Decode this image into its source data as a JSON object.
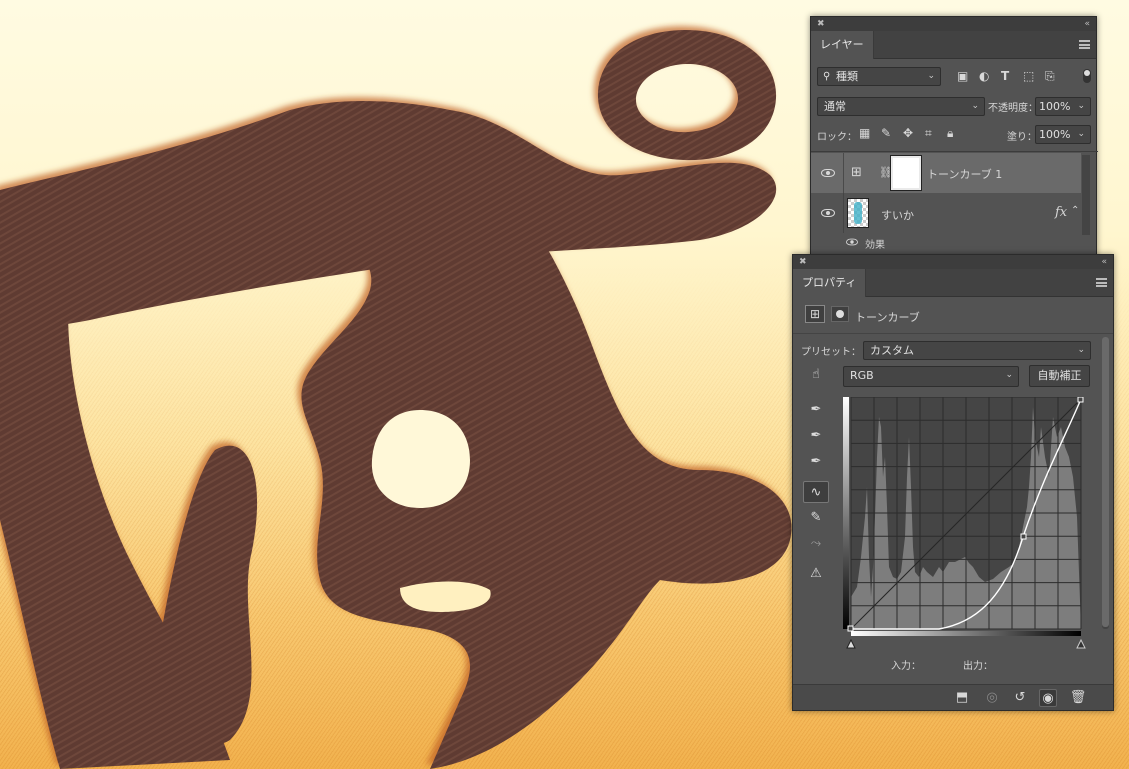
{
  "layers_panel": {
    "tab_label": "レイヤー",
    "filter_label": "種類",
    "blend_mode": "通常",
    "opacity_label": "不透明度：",
    "opacity_value": "100%",
    "lock_label": "ロック：",
    "fill_label": "塗り：",
    "fill_value": "100%",
    "layers": [
      {
        "name": "トーンカーブ 1",
        "type": "adjustment",
        "selected": true
      },
      {
        "name": "すいか",
        "type": "pixel",
        "fx": "fx"
      }
    ],
    "effects_label": "効果"
  },
  "properties_panel": {
    "tab_label": "プロパティ",
    "header_label": "トーンカーブ",
    "preset_label": "プリセット：",
    "preset_value": "カスタム",
    "channel_value": "RGB",
    "auto_button": "自動補正",
    "input_label": "入力：",
    "output_label": "出力："
  },
  "colors": {
    "panel_bg": "#535353",
    "panel_dark": "#424242",
    "selected_row": "#6a6a6a",
    "glyph_brown": "#5c3a31",
    "canvas_light": "#fff6cf",
    "canvas_orange": "#f2b24e"
  }
}
